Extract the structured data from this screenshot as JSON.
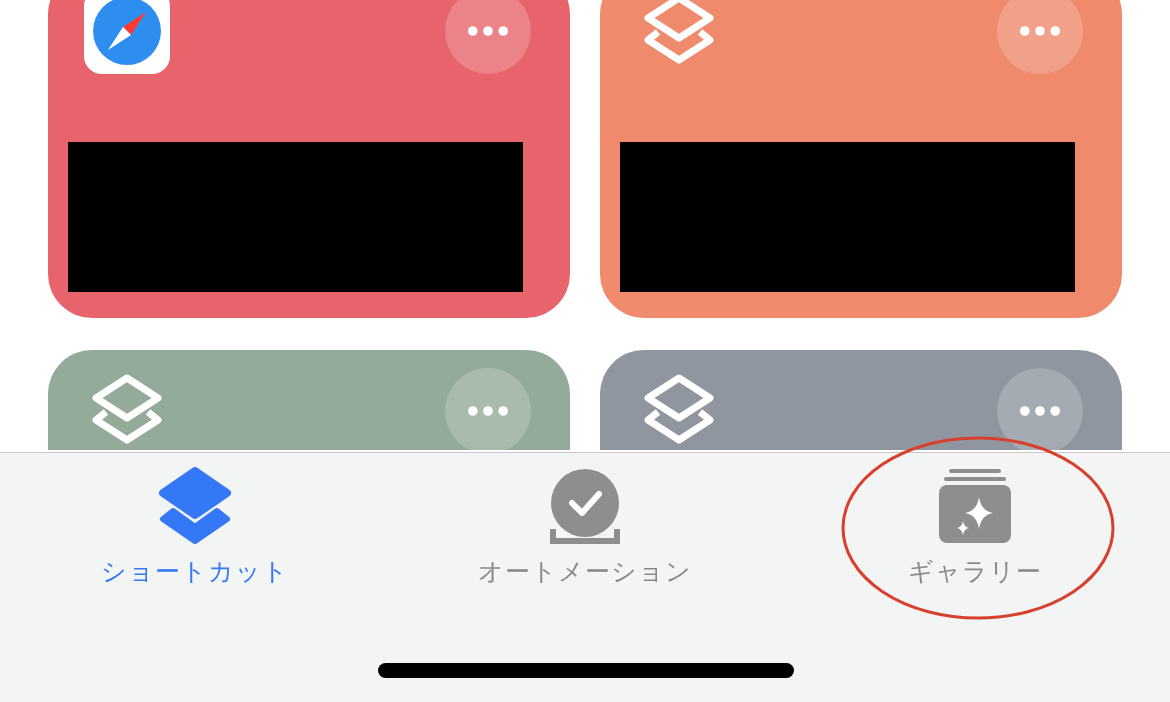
{
  "cards": [
    {
      "kind": "safari",
      "color": "#e8646c"
    },
    {
      "kind": "shortcuts",
      "color": "#ef8a6c"
    },
    {
      "kind": "shortcuts",
      "color": "#93ab98"
    },
    {
      "kind": "shortcuts",
      "color": "#8f96a0"
    }
  ],
  "tabs": [
    {
      "kind": "shortcuts",
      "label": "ショートカット",
      "selected": true,
      "circled": false
    },
    {
      "kind": "automation",
      "label": "オートメーション",
      "selected": false,
      "circled": false
    },
    {
      "kind": "gallery",
      "label": "ギャラリー",
      "selected": false,
      "circled": true
    }
  ]
}
